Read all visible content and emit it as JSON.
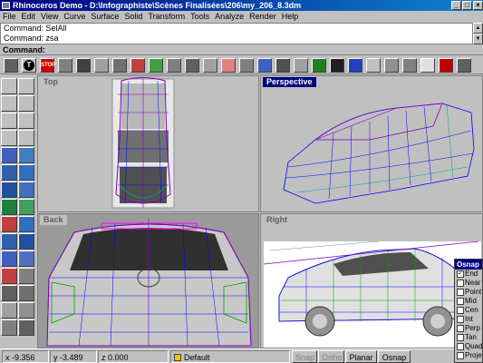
{
  "window": {
    "title": "Rhinoceros Demo - D:\\Infographiste\\Scènes Finalisées\\206\\my_206_8.3dm",
    "minimize_glyph": "_",
    "maximize_glyph": "□",
    "close_glyph": "×"
  },
  "menu": [
    "File",
    "Edit",
    "View",
    "Curve",
    "Surface",
    "Solid",
    "Transform",
    "Tools",
    "Analyze",
    "Render",
    "Help"
  ],
  "command_history": [
    "Command: SelAll",
    "Command: zsa"
  ],
  "command_prompt": "Command:",
  "viewports": {
    "top": "Top",
    "perspective": "Perspective",
    "back": "Back",
    "right": "Right"
  },
  "status": {
    "x": "x  -9.356",
    "y": "y  -3.489",
    "z": "z  0.000",
    "layer": "Default",
    "layer_color": "#f0c000",
    "snap": "Snap",
    "ortho": "Ortho",
    "planar": "Planar",
    "osnap": "Osnap"
  },
  "osnap_panel": {
    "title": "Osnap",
    "items": [
      {
        "label": "End",
        "checked": true
      },
      {
        "label": "Near",
        "checked": false
      },
      {
        "label": "Point",
        "checked": false
      },
      {
        "label": "Mid",
        "checked": false
      },
      {
        "label": "Cen",
        "checked": false
      },
      {
        "label": "Int",
        "checked": false
      },
      {
        "label": "Perp",
        "checked": false
      },
      {
        "label": "Tan",
        "checked": false
      },
      {
        "label": "Quad",
        "checked": false
      },
      {
        "label": "Proje",
        "checked": false
      }
    ]
  },
  "toolbar_icons": [
    "standard-icon",
    "text-icon",
    "stop-icon",
    "camera-icon",
    "layer-icon",
    "properties-icon",
    "render-icon",
    "light-icon",
    "color-icon",
    "wire-icon",
    "text-title-icon",
    "exit-icon"
  ]
}
